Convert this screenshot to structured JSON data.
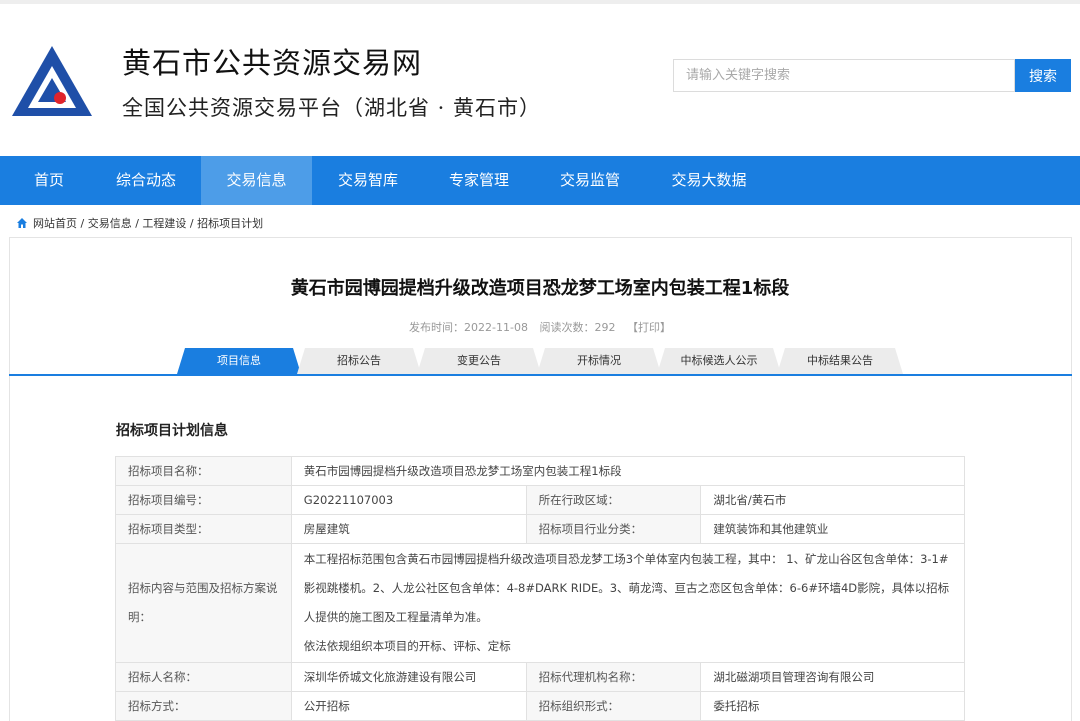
{
  "header": {
    "site_title": "黄石市公共资源交易网",
    "site_subtitle": "全国公共资源交易平台（湖北省 · 黄石市）",
    "search_placeholder": "请输入关键字搜索",
    "search_button": "搜索"
  },
  "colors": {
    "primary": "#1a7ee0",
    "nav_active": "#4d9de8",
    "logo_blue": "#1f4fa8",
    "logo_red": "#e0242b"
  },
  "nav": {
    "items": [
      {
        "label": "首页"
      },
      {
        "label": "综合动态"
      },
      {
        "label": "交易信息"
      },
      {
        "label": "交易智库"
      },
      {
        "label": "专家管理"
      },
      {
        "label": "交易监管"
      },
      {
        "label": "交易大数据"
      }
    ]
  },
  "breadcrumb": {
    "icon": "home-icon",
    "text": "网站首页 / 交易信息 / 工程建设 / 招标项目计划"
  },
  "article": {
    "title": "黄石市园博园提档升级改造项目恐龙梦工场室内包装工程1标段",
    "publish_label": "发布时间：2022-11-08",
    "views_label": "阅读次数：292",
    "print_label": "【打印】"
  },
  "tabs": [
    {
      "label": "项目信息"
    },
    {
      "label": "招标公告"
    },
    {
      "label": "变更公告"
    },
    {
      "label": "开标情况"
    },
    {
      "label": "中标候选人公示"
    },
    {
      "label": "中标结果公告"
    }
  ],
  "section": {
    "title": "招标项目计划信息",
    "rows": {
      "name": {
        "label": "招标项目名称：",
        "value": "黄石市园博园提档升级改造项目恐龙梦工场室内包装工程1标段"
      },
      "code": {
        "label": "招标项目编号：",
        "value": "G20221107003",
        "label2": "所在行政区域：",
        "value2": "湖北省/黄石市"
      },
      "type": {
        "label": "招标项目类型：",
        "value": "房屋建筑",
        "label2": "招标项目行业分类：",
        "value2": "建筑装饰和其他建筑业"
      },
      "scope": {
        "label": "招标内容与范围及招标方案说明：",
        "line1": "本工程招标范围包含黄石市园博园提档升级改造项目恐龙梦工场3个单体室内包装工程，其中： 1、矿龙山谷区包含单体：3-1#影视跳楼机。2、人龙公社区包含单体：4-8#DARK RIDE。3、萌龙湾、亘古之恋区包含单体：6-6#环墙4D影院，具体以招标人提供的施工图及工程量清单为准。",
        "line2": "依法依规组织本项目的开标、评标、定标"
      },
      "tenderer": {
        "label": "招标人名称：",
        "value": "深圳华侨城文化旅游建设有限公司",
        "label2": "招标代理机构名称：",
        "value2": "湖北磁湖项目管理咨询有限公司"
      },
      "method": {
        "label": "招标方式：",
        "value": "公开招标",
        "label2": "招标组织形式：",
        "value2": "委托招标"
      }
    }
  }
}
